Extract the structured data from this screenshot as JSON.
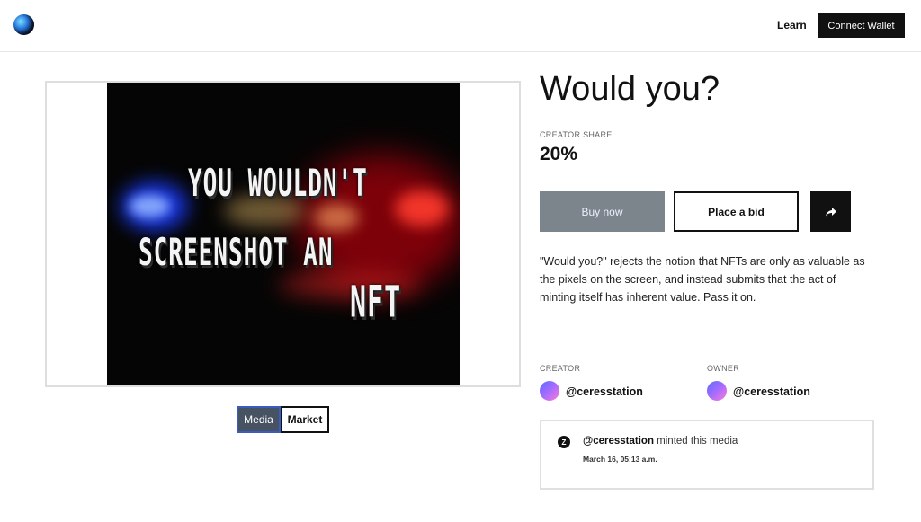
{
  "header": {
    "logo_icon": "globe-logo-icon",
    "learn_label": "Learn",
    "connect_label": "Connect Wallet"
  },
  "media": {
    "art_line_1": "YOU WOULDN'T",
    "art_line_2": "SCREENSHOT AN",
    "art_line_3": "NFT",
    "tabs": [
      {
        "label": "Media",
        "active": true
      },
      {
        "label": "Market",
        "active": false
      }
    ]
  },
  "item": {
    "title": "Would you?",
    "creator_share_label": "CREATOR SHARE",
    "creator_share_value": "20%",
    "buy_label": "Buy now",
    "bid_label": "Place a bid",
    "share_icon": "share-arrow-icon",
    "description": "\"Would you?\" rejects the notion that NFTs are only as valuable as the pixels on the screen, and instead submits that the act of minting itself has inherent value. Pass it on."
  },
  "people": {
    "creator_label": "CREATOR",
    "creator_handle": "@ceresstation",
    "owner_label": "OWNER",
    "owner_handle": "@ceresstation"
  },
  "history": {
    "icon": "zora-icon",
    "icon_glyph": "Z",
    "actor": "@ceresstation",
    "action": " minted this media",
    "timestamp": "March 16, 05:13 a.m."
  },
  "colors": {
    "buy_button": "#7b858b",
    "active_tab": "#475263",
    "dark": "#111111"
  }
}
